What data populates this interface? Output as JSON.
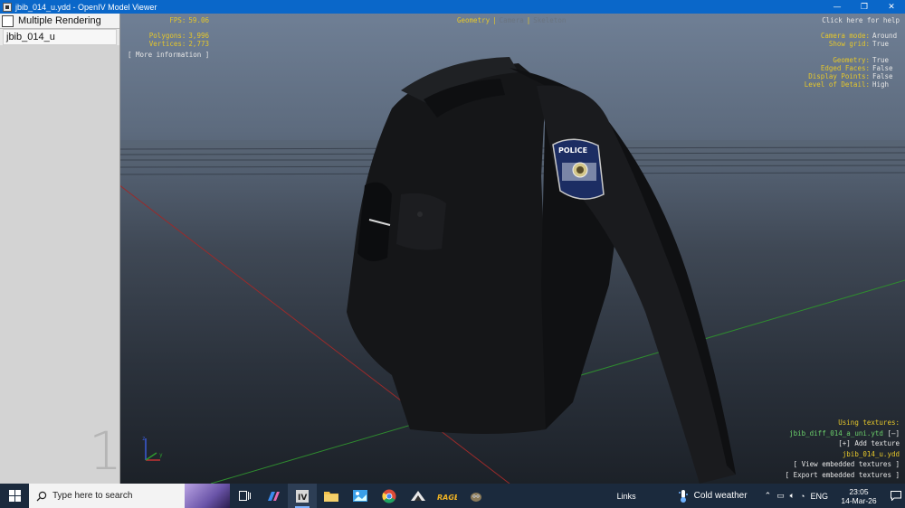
{
  "window": {
    "title": "jbib_014_u.ydd - OpenIV Model Viewer",
    "minimize": "—",
    "restore": "❐",
    "close": "✕"
  },
  "left_panel": {
    "multiple_rendering_label": "Multiple Rendering",
    "multiple_rendering_checked": false,
    "models": [
      "jbib_014_u"
    ],
    "viewport_index": "1"
  },
  "hud": {
    "fps_label": "FPS:",
    "fps_value": "59.06",
    "polygons_label": "Polygons:",
    "polygons_value": "3,996",
    "vertices_label": "Vertices:",
    "vertices_value": "2,773",
    "more_info": "[ More information ]",
    "tabs": [
      "Geometry",
      "Camera",
      "Skeleton"
    ],
    "help": "Click here for help",
    "settings": [
      {
        "label": "Camera mode:",
        "value": "Around"
      },
      {
        "label": "Show grid:",
        "value": "True"
      },
      {
        "label": "",
        "value": ""
      },
      {
        "label": "Geometry:",
        "value": "True"
      },
      {
        "label": "Edged Faces:",
        "value": "False"
      },
      {
        "label": "Display Points:",
        "value": "False"
      },
      {
        "label": "Level of Detail:",
        "value": "High"
      }
    ],
    "textures": {
      "heading": "Using textures:",
      "texture_file": "jbib_diff_014_a_uni.ytd",
      "texture_toggle": "[–]",
      "add_texture": "[+] Add texture",
      "model_file": "jbib_014_u.ydd",
      "view_embedded": "[ View embedded textures ]",
      "export_embedded": "[ Export embedded textures ]"
    },
    "patch_text": "POLICE",
    "axis_labels": {
      "y": "y",
      "z": "z"
    }
  },
  "taskbar": {
    "search_placeholder": "Type here to search",
    "links_label": "Links",
    "weather_label": "Cold weather",
    "language": "ENG",
    "time": "23:05",
    "date": "14-Mar-26"
  },
  "colors": {
    "titlebar": "#0a67c9",
    "hud_yellow": "#e6c72a",
    "hud_green": "#6bd06b",
    "taskbar": "#1b2a3d"
  }
}
